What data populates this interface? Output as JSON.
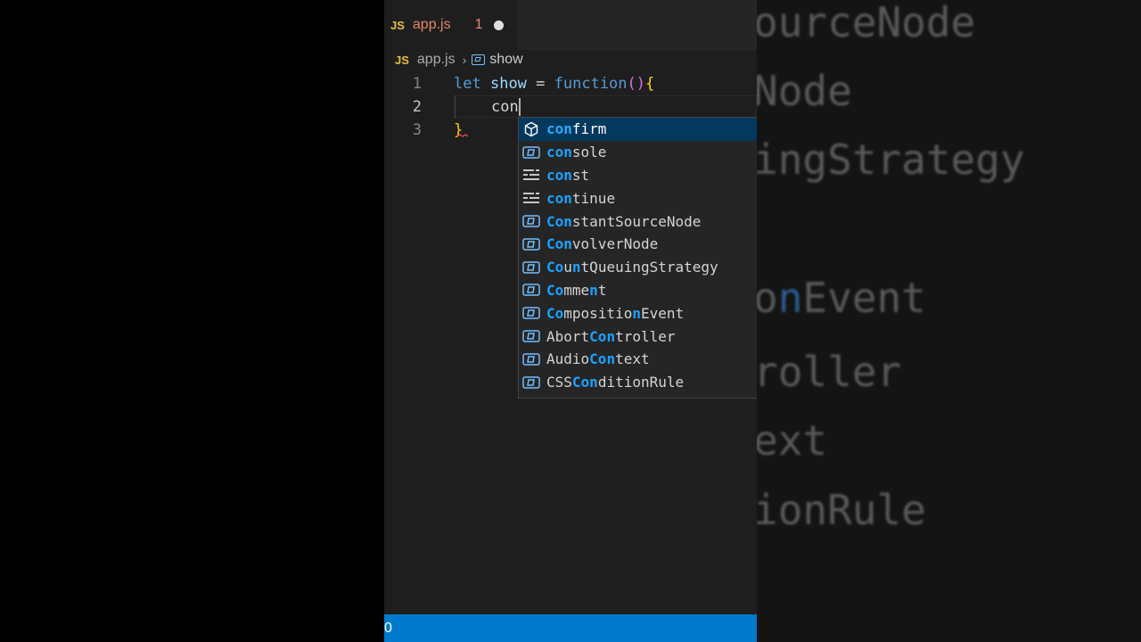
{
  "tab": {
    "icon": "JS",
    "filename": "app.js",
    "problems": "1"
  },
  "breadcrumb": {
    "icon": "JS",
    "file": "app.js",
    "symbol": "show"
  },
  "code": {
    "line_numbers": [
      "1",
      "2",
      "3"
    ],
    "line1": {
      "kw": "let",
      "var": "show",
      "op": " = ",
      "fn": "function",
      "paren": "()",
      "brace": "{"
    },
    "line2": {
      "typed": "con"
    },
    "line3": {
      "brace": "}"
    }
  },
  "suggestions": [
    {
      "icon": "keyword-icon-selected",
      "pre": "",
      "m1": "con",
      "mid": "",
      "m2": "",
      "post": "firm"
    },
    {
      "icon": "variable-icon",
      "pre": "",
      "m1": "con",
      "mid": "",
      "m2": "",
      "post": "sole"
    },
    {
      "icon": "keyword-icon",
      "pre": "",
      "m1": "con",
      "mid": "",
      "m2": "",
      "post": "st"
    },
    {
      "icon": "keyword-icon",
      "pre": "",
      "m1": "con",
      "mid": "",
      "m2": "",
      "post": "tinue"
    },
    {
      "icon": "variable-icon",
      "pre": "",
      "m1": "Con",
      "mid": "",
      "m2": "",
      "post": "stantSourceNode"
    },
    {
      "icon": "variable-icon",
      "pre": "",
      "m1": "Con",
      "mid": "",
      "m2": "",
      "post": "volverNode"
    },
    {
      "icon": "variable-icon",
      "pre": "",
      "m1": "Co",
      "mid": "u",
      "m2": "n",
      "post": "tQueuingStrategy"
    },
    {
      "icon": "variable-icon",
      "pre": "",
      "m1": "Co",
      "mid": "mme",
      "m2": "n",
      "post": "t"
    },
    {
      "icon": "variable-icon",
      "pre": "",
      "m1": "Co",
      "mid": "mpositio",
      "m2": "n",
      "post": "Event"
    },
    {
      "icon": "variable-icon",
      "pre": "Abort",
      "m1": "Con",
      "mid": "",
      "m2": "",
      "post": "troller"
    },
    {
      "icon": "variable-icon",
      "pre": "Audio",
      "m1": "Con",
      "mid": "",
      "m2": "",
      "post": "text"
    },
    {
      "icon": "variable-icon",
      "pre": "CSS",
      "m1": "Con",
      "mid": "",
      "m2": "",
      "post": "ditionRule"
    }
  ],
  "background": {
    "lines": [
      {
        "pre": "ourceNode",
        "hl": "",
        "post": ""
      },
      {
        "pre": "Node",
        "hl": "",
        "post": ""
      },
      {
        "pre": "ingStrategy",
        "hl": "",
        "post": ""
      },
      {
        "pre": "o",
        "hl": "n",
        "post": "Event"
      },
      {
        "pre": "roller",
        "hl": "",
        "post": ""
      },
      {
        "pre": "ext",
        "hl": "",
        "post": ""
      },
      {
        "pre": "ionRule",
        "hl": "",
        "post": ""
      }
    ]
  },
  "statusbar": {
    "text": "0"
  },
  "colors": {
    "accent": "#007acc",
    "selection": "#04395e",
    "match": "#18a3ff"
  }
}
